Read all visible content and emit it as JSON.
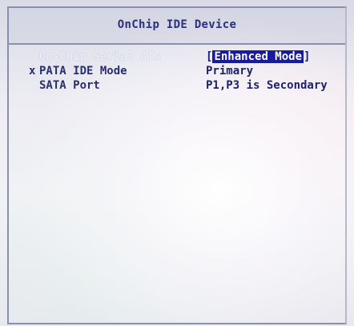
{
  "header": {
    "title": "OnChip IDE Device"
  },
  "settings": [
    {
      "marker": "",
      "label": "On-Chip Serial ATA",
      "value": "Enhanced Mode"
    },
    {
      "marker": "x",
      "label": "PATA IDE Mode",
      "value": "Primary"
    },
    {
      "marker": "",
      "label": "SATA Port",
      "value": "P1,P3 is Secondary"
    }
  ],
  "brackets": {
    "open": "[",
    "close": "]"
  },
  "colors": {
    "title": "#2b2f7e",
    "highlight_bg": "#181c9a",
    "text": "#2a2f6e"
  }
}
